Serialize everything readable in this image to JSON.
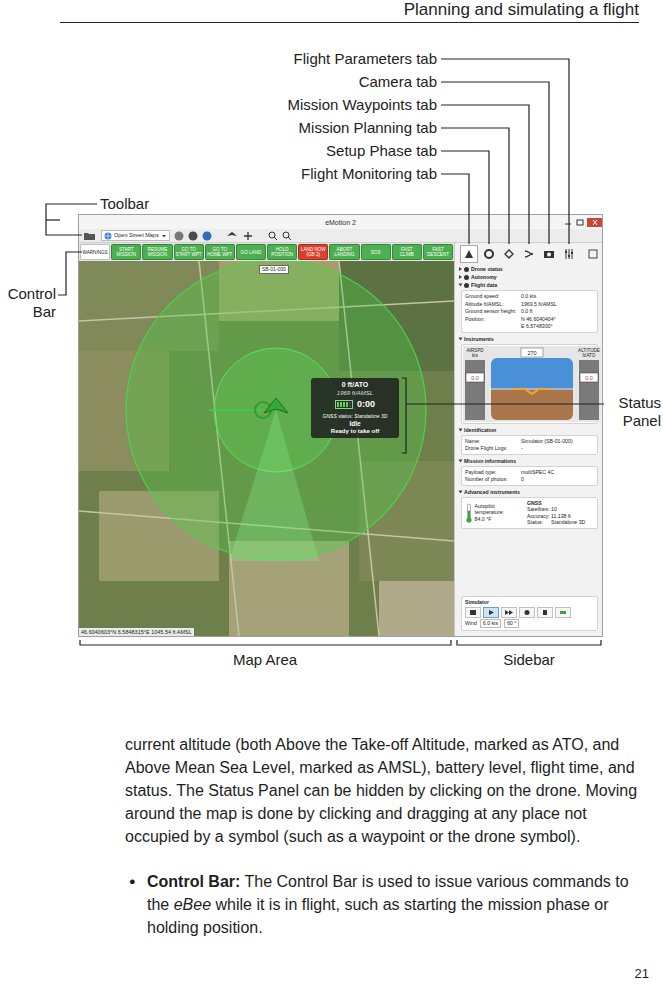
{
  "page": {
    "header": "Planning and simulating a flight",
    "number": "21"
  },
  "callouts": {
    "toolbar": "Toolbar",
    "control_bar": "Control Bar",
    "status_panel": "Status Panel",
    "map_area": "Map Area",
    "sidebar": "Sidebar"
  },
  "app": {
    "window": {
      "title": "eMotion 2"
    },
    "toolbar": {
      "map_source": "Open Street Maps"
    },
    "control_bar": [
      {
        "label": "WARNINGS",
        "color": "#ffffff"
      },
      {
        "label": "START MISSION",
        "color": "#4caf50"
      },
      {
        "label": "RESUME MISSION",
        "color": "#4caf50"
      },
      {
        "label": "GO TO START WPT",
        "color": "#4caf50"
      },
      {
        "label": "GO TO HOME WPT",
        "color": "#4caf50"
      },
      {
        "label": "GO LAND",
        "color": "#4caf50"
      },
      {
        "label": "HOLD POSITION",
        "color": "#4caf50"
      },
      {
        "label": "LAND NOW (GB 2)",
        "color": "#d9412f"
      },
      {
        "label": "ABORT LANDING",
        "color": "#4caf50"
      },
      {
        "label": "SOS",
        "color": "#4caf50"
      },
      {
        "label": "FAST CLIMB",
        "color": "#4caf50"
      },
      {
        "label": "FAST DESCENT",
        "color": "#4caf50"
      }
    ],
    "map": {
      "drone_label": "SB-01-000",
      "coordinates": "46.6040603°N 6.5848315°E 1045.54 ft AMSL"
    },
    "status_panel": {
      "altitude_ato": "0 ft/ATO",
      "altitude_amsl": "1969 ft/AMSL",
      "battery_level": 0.8,
      "flight_time": "0:00",
      "gnss": "GNSS status: Standalone 3D",
      "state": "Idle",
      "message": "Ready to take off"
    },
    "sidebar": {
      "tabs": [
        {
          "callout": "Flight Monitoring tab",
          "selected": true
        },
        {
          "callout": "Setup Phase tab",
          "selected": false
        },
        {
          "callout": "Mission Planning tab",
          "selected": false
        },
        {
          "callout": "Mission Waypoints tab",
          "selected": false
        },
        {
          "callout": "Camera tab",
          "selected": false
        },
        {
          "callout": "Flight Parameters tab",
          "selected": false
        }
      ],
      "status_items": [
        {
          "label": "Drone status",
          "expanded": false
        },
        {
          "label": "Autonomy",
          "expanded": false
        },
        {
          "label": "Flight data",
          "expanded": true
        }
      ],
      "flight_data": [
        {
          "label": "Ground speed:",
          "value": "0.0 kts"
        },
        {
          "label": "Altitude ft/AMSL:",
          "value": "1969.5 ft/AMSL"
        },
        {
          "label": "Ground sensor height:",
          "value": "0.0 ft"
        },
        {
          "label": "Position:",
          "value": "N 46.6040404°"
        },
        {
          "label": "",
          "value": "E 6.5748300°"
        }
      ],
      "instruments": {
        "title": "Instruments",
        "airspeed_label": "AIRSPD",
        "airspeed_unit": "kts",
        "altitude_label": "ALTITUDE",
        "altitude_unit": "ft/ATO",
        "airspeed": "0.0",
        "altitude": "0.0",
        "heading": "270"
      },
      "identification": {
        "title": "Identification",
        "rows": [
          {
            "label": "Name:",
            "value": "Simulator (SB-01-000)"
          },
          {
            "label": "Drone Flight Logs:",
            "value": "-"
          }
        ]
      },
      "mission": {
        "title": "Mission informations",
        "rows": [
          {
            "label": "Payload type:",
            "value": "multiSPEC 4C"
          },
          {
            "label": "Number of photos:",
            "value": "0"
          }
        ]
      },
      "advanced": {
        "title": "Advanced instruments",
        "temperature_label": "Autopilot temperature:",
        "temperature": "84.0 °F",
        "thermometer_level": 0.6,
        "gnss_title": "GNSS",
        "gnss_rows": [
          {
            "label": "Satellites:",
            "value": "10"
          },
          {
            "label": "Accuracy:",
            "value": "11.138 ft"
          },
          {
            "label": "Status:",
            "value": "Standalone 3D"
          }
        ]
      },
      "simulator": {
        "title": "Simulator",
        "controls": [
          {
            "selected": false
          },
          {
            "selected": true
          },
          {
            "selected": false
          },
          {
            "selected": false
          },
          {
            "selected": false
          },
          {
            "selected": false
          }
        ],
        "wind_label": "Wind",
        "wind_speed": "6.0 kts",
        "wind_direction": "60 °"
      }
    }
  },
  "body": {
    "paragraph": "current altitude (both Above the Take-off Altitude, marked as ATO, and Above Mean Sea Level, marked as AMSL), battery level, flight time, and status.  The Status Panel can be hidden by clicking on the drone.  Moving around the map is done by clicking and dragging at any place not occupied by a symbol (such as a waypoint or the drone symbol).",
    "bullets": [
      {
        "marker": "●",
        "label": "Control Bar:",
        "before": " The Control Bar is used to issue various commands to the ",
        "emphasis": "eBee",
        "after": " while it is in flight, such as starting the mission phase or holding position."
      }
    ]
  }
}
